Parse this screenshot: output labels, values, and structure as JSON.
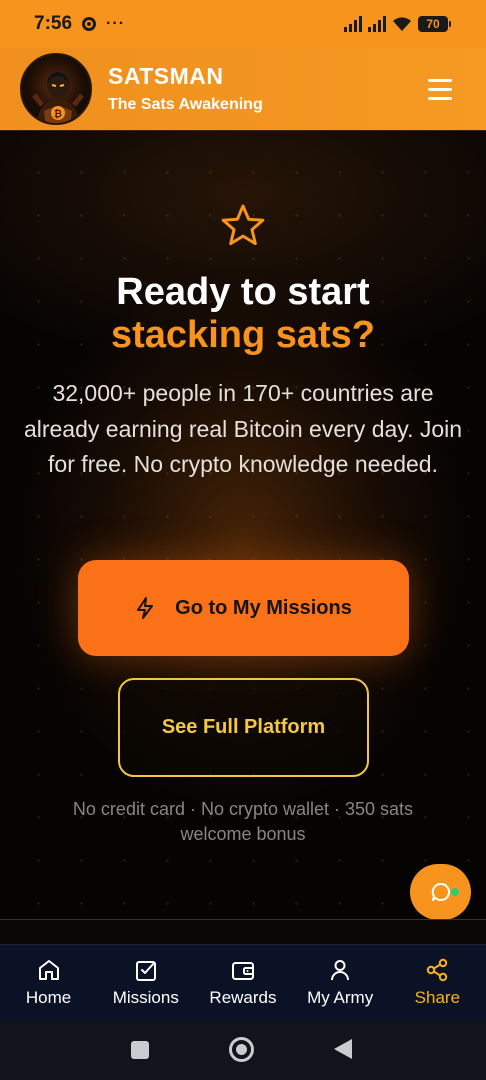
{
  "status_bar": {
    "time": "7:56",
    "more": "···",
    "battery": "70"
  },
  "header": {
    "title": "SATSMAN",
    "subtitle": "The Sats Awakening"
  },
  "hero": {
    "headline_line1": "Ready to start",
    "headline_line2": "stacking sats?",
    "description": "32,000+ people in 170+ countries are already earning real Bitcoin every day. Join for free. No crypto knowledge needed.",
    "primary_button": "Go to My Missions",
    "secondary_button": "See Full Platform",
    "fineprint": "No credit card · No crypto wallet · 350 sats welcome bonus"
  },
  "bottom_nav": {
    "items": [
      {
        "label": "Home",
        "icon": "home-icon"
      },
      {
        "label": "Missions",
        "icon": "checkbox-icon"
      },
      {
        "label": "Rewards",
        "icon": "wallet-icon"
      },
      {
        "label": "My Army",
        "icon": "user-icon"
      },
      {
        "label": "Share",
        "icon": "share-icon"
      }
    ],
    "active": "Share"
  },
  "colors": {
    "brand_orange": "#f7941d",
    "cta_orange": "#fb7118",
    "gold": "#f5c842",
    "nav_bg": "#0c1226",
    "online": "#2ecc71"
  }
}
